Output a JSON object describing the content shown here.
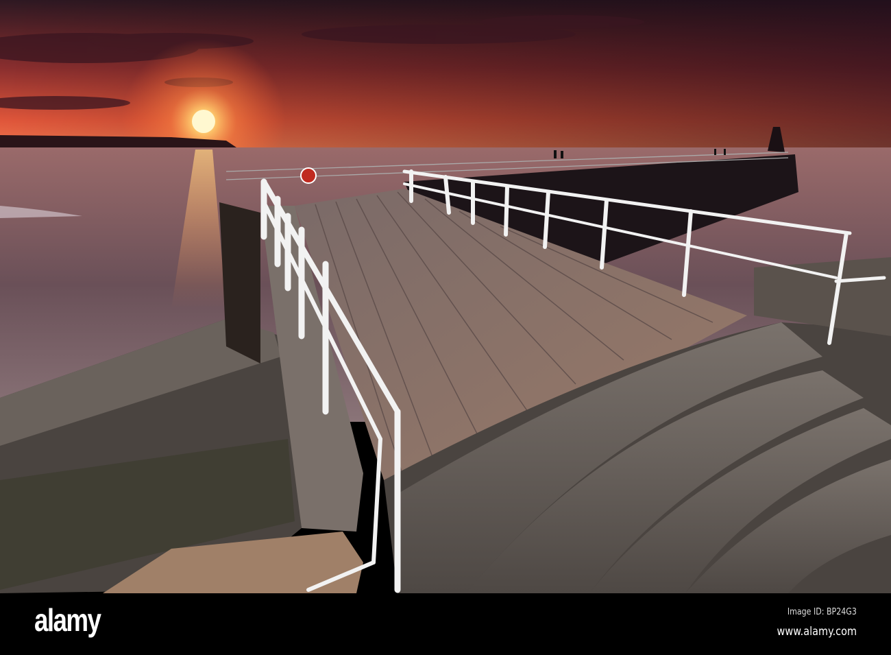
{
  "photo": {
    "subject": "pier",
    "colors": {
      "sky_top": "#3a1a2a",
      "sky_glow": "#f0603a",
      "sun": "#fff4c0",
      "sea": "#6a4a50",
      "deck": "#8a7068",
      "rail": "#f2f2f2",
      "stone": "#6a625e"
    }
  },
  "watermark": {
    "logo": "alamy",
    "image_id": "Image ID: BP24G3",
    "site": "www.alamy.com"
  }
}
